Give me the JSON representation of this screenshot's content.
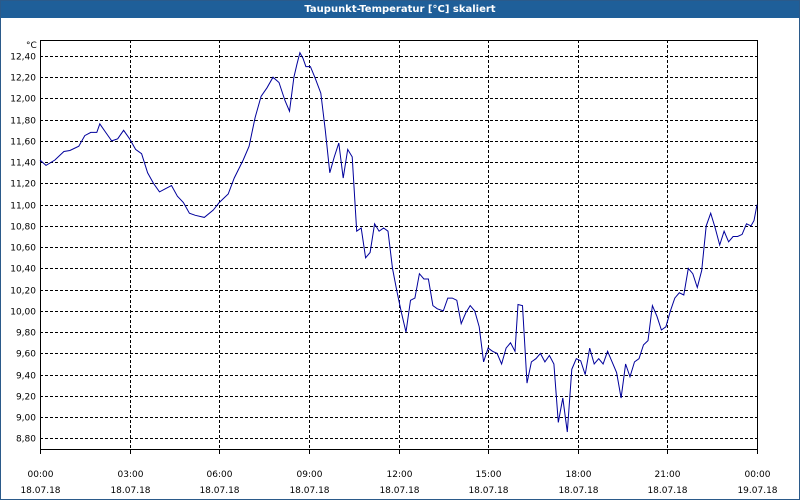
{
  "window": {
    "title": "Taupunkt-Temperatur [°C] skaliert"
  },
  "colors": {
    "line": "#00009c",
    "grid": "#000000",
    "titlebar": "#1f5f99"
  },
  "chart_data": {
    "type": "line",
    "title": "Taupunkt-Temperatur [°C] skaliert",
    "ylabel": "°C",
    "xlabel": "",
    "ylim": [
      8.7,
      12.55
    ],
    "xlim": [
      0,
      24
    ],
    "grid": true,
    "y_ticks": [
      "12,40",
      "12,20",
      "12,00",
      "11,80",
      "11,60",
      "11,40",
      "11,20",
      "11,00",
      "10,80",
      "10,60",
      "10,40",
      "10,20",
      "10,00",
      "9,80",
      "9,60",
      "9,40",
      "9,20",
      "9,00",
      "8,80"
    ],
    "y_tick_values": [
      12.4,
      12.2,
      12.0,
      11.8,
      11.6,
      11.4,
      11.2,
      11.0,
      10.8,
      10.6,
      10.4,
      10.2,
      10.0,
      9.8,
      9.6,
      9.4,
      9.2,
      9.0,
      8.8
    ],
    "x_ticks": [
      {
        "time": "00:00",
        "date": "18.07.18"
      },
      {
        "time": "03:00",
        "date": "18.07.18"
      },
      {
        "time": "06:00",
        "date": "18.07.18"
      },
      {
        "time": "09:00",
        "date": "18.07.18"
      },
      {
        "time": "12:00",
        "date": "18.07.18"
      },
      {
        "time": "15:00",
        "date": "18.07.18"
      },
      {
        "time": "18:00",
        "date": "18.07.18"
      },
      {
        "time": "21:00",
        "date": "18.07.18"
      },
      {
        "time": "00:00",
        "date": "19.07.18"
      }
    ],
    "x_tick_hours": [
      0,
      3,
      6,
      9,
      12,
      15,
      18,
      21,
      24
    ],
    "series": [
      {
        "points": [
          [
            0,
            11.42
          ],
          [
            0.2,
            11.37
          ],
          [
            0.5,
            11.42
          ],
          [
            0.8,
            11.5
          ],
          [
            1.0,
            11.51
          ],
          [
            1.3,
            11.55
          ],
          [
            1.5,
            11.65
          ],
          [
            1.7,
            11.68
          ],
          [
            1.9,
            11.68
          ],
          [
            2.0,
            11.76
          ],
          [
            2.2,
            11.68
          ],
          [
            2.4,
            11.6
          ],
          [
            2.6,
            11.62
          ],
          [
            2.8,
            11.7
          ],
          [
            3.0,
            11.62
          ],
          [
            3.2,
            11.52
          ],
          [
            3.4,
            11.48
          ],
          [
            3.6,
            11.3
          ],
          [
            3.8,
            11.2
          ],
          [
            4.0,
            11.12
          ],
          [
            4.2,
            11.15
          ],
          [
            4.4,
            11.18
          ],
          [
            4.6,
            11.08
          ],
          [
            4.8,
            11.02
          ],
          [
            5.0,
            10.92
          ],
          [
            5.2,
            10.9
          ],
          [
            5.5,
            10.88
          ],
          [
            5.8,
            10.95
          ],
          [
            6.0,
            11.02
          ],
          [
            6.3,
            11.1
          ],
          [
            6.5,
            11.25
          ],
          [
            6.8,
            11.42
          ],
          [
            7.0,
            11.55
          ],
          [
            7.2,
            11.82
          ],
          [
            7.4,
            12.02
          ],
          [
            7.6,
            12.1
          ],
          [
            7.8,
            12.2
          ],
          [
            8.0,
            12.15
          ],
          [
            8.2,
            11.98
          ],
          [
            8.35,
            11.88
          ],
          [
            8.5,
            12.2
          ],
          [
            8.6,
            12.32
          ],
          [
            8.7,
            12.43
          ],
          [
            8.8,
            12.38
          ],
          [
            8.9,
            12.3
          ],
          [
            9.05,
            12.3
          ],
          [
            9.2,
            12.2
          ],
          [
            9.4,
            12.05
          ],
          [
            9.55,
            11.7
          ],
          [
            9.7,
            11.3
          ],
          [
            9.85,
            11.45
          ],
          [
            10.0,
            11.58
          ],
          [
            10.15,
            11.25
          ],
          [
            10.3,
            11.52
          ],
          [
            10.45,
            11.45
          ],
          [
            10.6,
            10.75
          ],
          [
            10.75,
            10.78
          ],
          [
            10.9,
            10.5
          ],
          [
            11.05,
            10.55
          ],
          [
            11.2,
            10.82
          ],
          [
            11.35,
            10.75
          ],
          [
            11.5,
            10.78
          ],
          [
            11.65,
            10.75
          ],
          [
            11.8,
            10.4
          ],
          [
            11.95,
            10.18
          ],
          [
            12.1,
            9.98
          ],
          [
            12.25,
            9.8
          ],
          [
            12.4,
            10.1
          ],
          [
            12.55,
            10.12
          ],
          [
            12.7,
            10.35
          ],
          [
            12.85,
            10.3
          ],
          [
            13.0,
            10.3
          ],
          [
            13.15,
            10.05
          ],
          [
            13.3,
            10.02
          ],
          [
            13.5,
            10.0
          ],
          [
            13.65,
            10.12
          ],
          [
            13.8,
            10.12
          ],
          [
            13.95,
            10.1
          ],
          [
            14.1,
            9.88
          ],
          [
            14.25,
            9.98
          ],
          [
            14.4,
            10.05
          ],
          [
            14.55,
            10.0
          ],
          [
            14.7,
            9.85
          ],
          [
            14.85,
            9.52
          ],
          [
            15.0,
            9.65
          ],
          [
            15.15,
            9.62
          ],
          [
            15.3,
            9.6
          ],
          [
            15.45,
            9.5
          ],
          [
            15.6,
            9.65
          ],
          [
            15.75,
            9.7
          ],
          [
            15.9,
            9.62
          ],
          [
            16.0,
            10.06
          ],
          [
            16.15,
            10.05
          ],
          [
            16.3,
            9.32
          ],
          [
            16.45,
            9.52
          ],
          [
            16.6,
            9.55
          ],
          [
            16.75,
            9.6
          ],
          [
            16.9,
            9.52
          ],
          [
            17.05,
            9.58
          ],
          [
            17.2,
            9.5
          ],
          [
            17.35,
            8.95
          ],
          [
            17.5,
            9.18
          ],
          [
            17.65,
            8.86
          ],
          [
            17.8,
            9.45
          ],
          [
            17.95,
            9.55
          ],
          [
            18.1,
            9.53
          ],
          [
            18.25,
            9.4
          ],
          [
            18.4,
            9.65
          ],
          [
            18.55,
            9.5
          ],
          [
            18.7,
            9.55
          ],
          [
            18.85,
            9.5
          ],
          [
            19.0,
            9.62
          ],
          [
            19.15,
            9.52
          ],
          [
            19.3,
            9.42
          ],
          [
            19.45,
            9.18
          ],
          [
            19.6,
            9.5
          ],
          [
            19.75,
            9.38
          ],
          [
            19.9,
            9.52
          ],
          [
            20.05,
            9.55
          ],
          [
            20.2,
            9.68
          ],
          [
            20.35,
            9.72
          ],
          [
            20.5,
            10.05
          ],
          [
            20.65,
            9.95
          ],
          [
            20.8,
            9.82
          ],
          [
            20.95,
            9.85
          ],
          [
            21.1,
            10.0
          ],
          [
            21.25,
            10.12
          ],
          [
            21.4,
            10.17
          ],
          [
            21.55,
            10.15
          ],
          [
            21.7,
            10.4
          ],
          [
            21.85,
            10.35
          ],
          [
            22.0,
            10.22
          ],
          [
            22.15,
            10.38
          ],
          [
            22.3,
            10.8
          ],
          [
            22.45,
            10.92
          ],
          [
            22.6,
            10.78
          ],
          [
            22.75,
            10.62
          ],
          [
            22.9,
            10.75
          ],
          [
            23.05,
            10.65
          ],
          [
            23.2,
            10.7
          ],
          [
            23.35,
            10.7
          ],
          [
            23.5,
            10.72
          ],
          [
            23.65,
            10.82
          ],
          [
            23.8,
            10.8
          ],
          [
            23.9,
            10.85
          ],
          [
            24.0,
            11.0
          ]
        ]
      }
    ]
  }
}
